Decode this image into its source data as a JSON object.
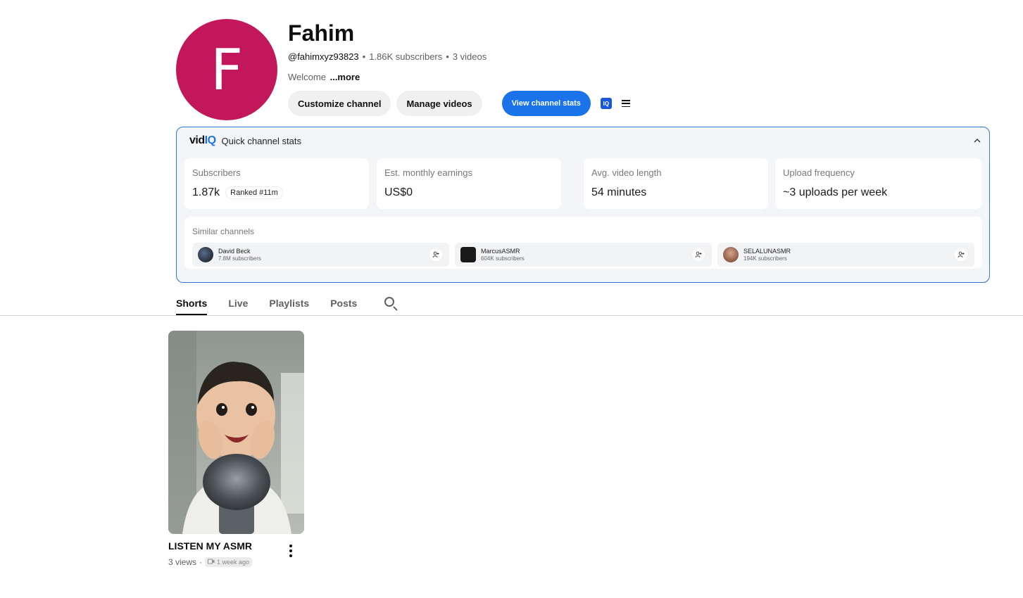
{
  "channel": {
    "avatar_letter": "F",
    "name": "Fahim",
    "handle": "@fahimxyz93823",
    "subscribers": "1.86K subscribers",
    "videos": "3 videos",
    "separator": "•",
    "description": "Welcome",
    "more": "...more"
  },
  "actions": {
    "customize": "Customize channel",
    "manage": "Manage videos",
    "stats": "View channel stats",
    "iq_badge": "IQ"
  },
  "vidiq": {
    "logo_a": "vid",
    "logo_b": "IQ",
    "title": "Quick channel stats",
    "collapse_icon": "chevron-up-icon",
    "stats": [
      {
        "label": "Subscribers",
        "value": "1.87k",
        "rank": "Ranked #11m"
      },
      {
        "label": "Est. monthly earnings",
        "value": "US$0"
      },
      {
        "label": "Avg. video length",
        "value": "54 minutes"
      },
      {
        "label": "Upload frequency",
        "value": "~3 uploads per week"
      }
    ],
    "similar_label": "Similar channels",
    "similar": [
      {
        "name": "David Beck",
        "subs": "7.8M subscribers"
      },
      {
        "name": "MarcusASMR",
        "subs": "604K subscribers"
      },
      {
        "name": "SELALUNASMR",
        "subs": "194K subscribers"
      }
    ]
  },
  "tabs": [
    "Shorts",
    "Live",
    "Playlists",
    "Posts"
  ],
  "short": {
    "title": "LISTEN MY ASMR",
    "views": "3 views",
    "dot": "·",
    "ago": "1 week ago"
  },
  "colors": {
    "avatar": "#c2185b",
    "accent": "#1a73e8",
    "panel_border": "#2f78d1"
  }
}
